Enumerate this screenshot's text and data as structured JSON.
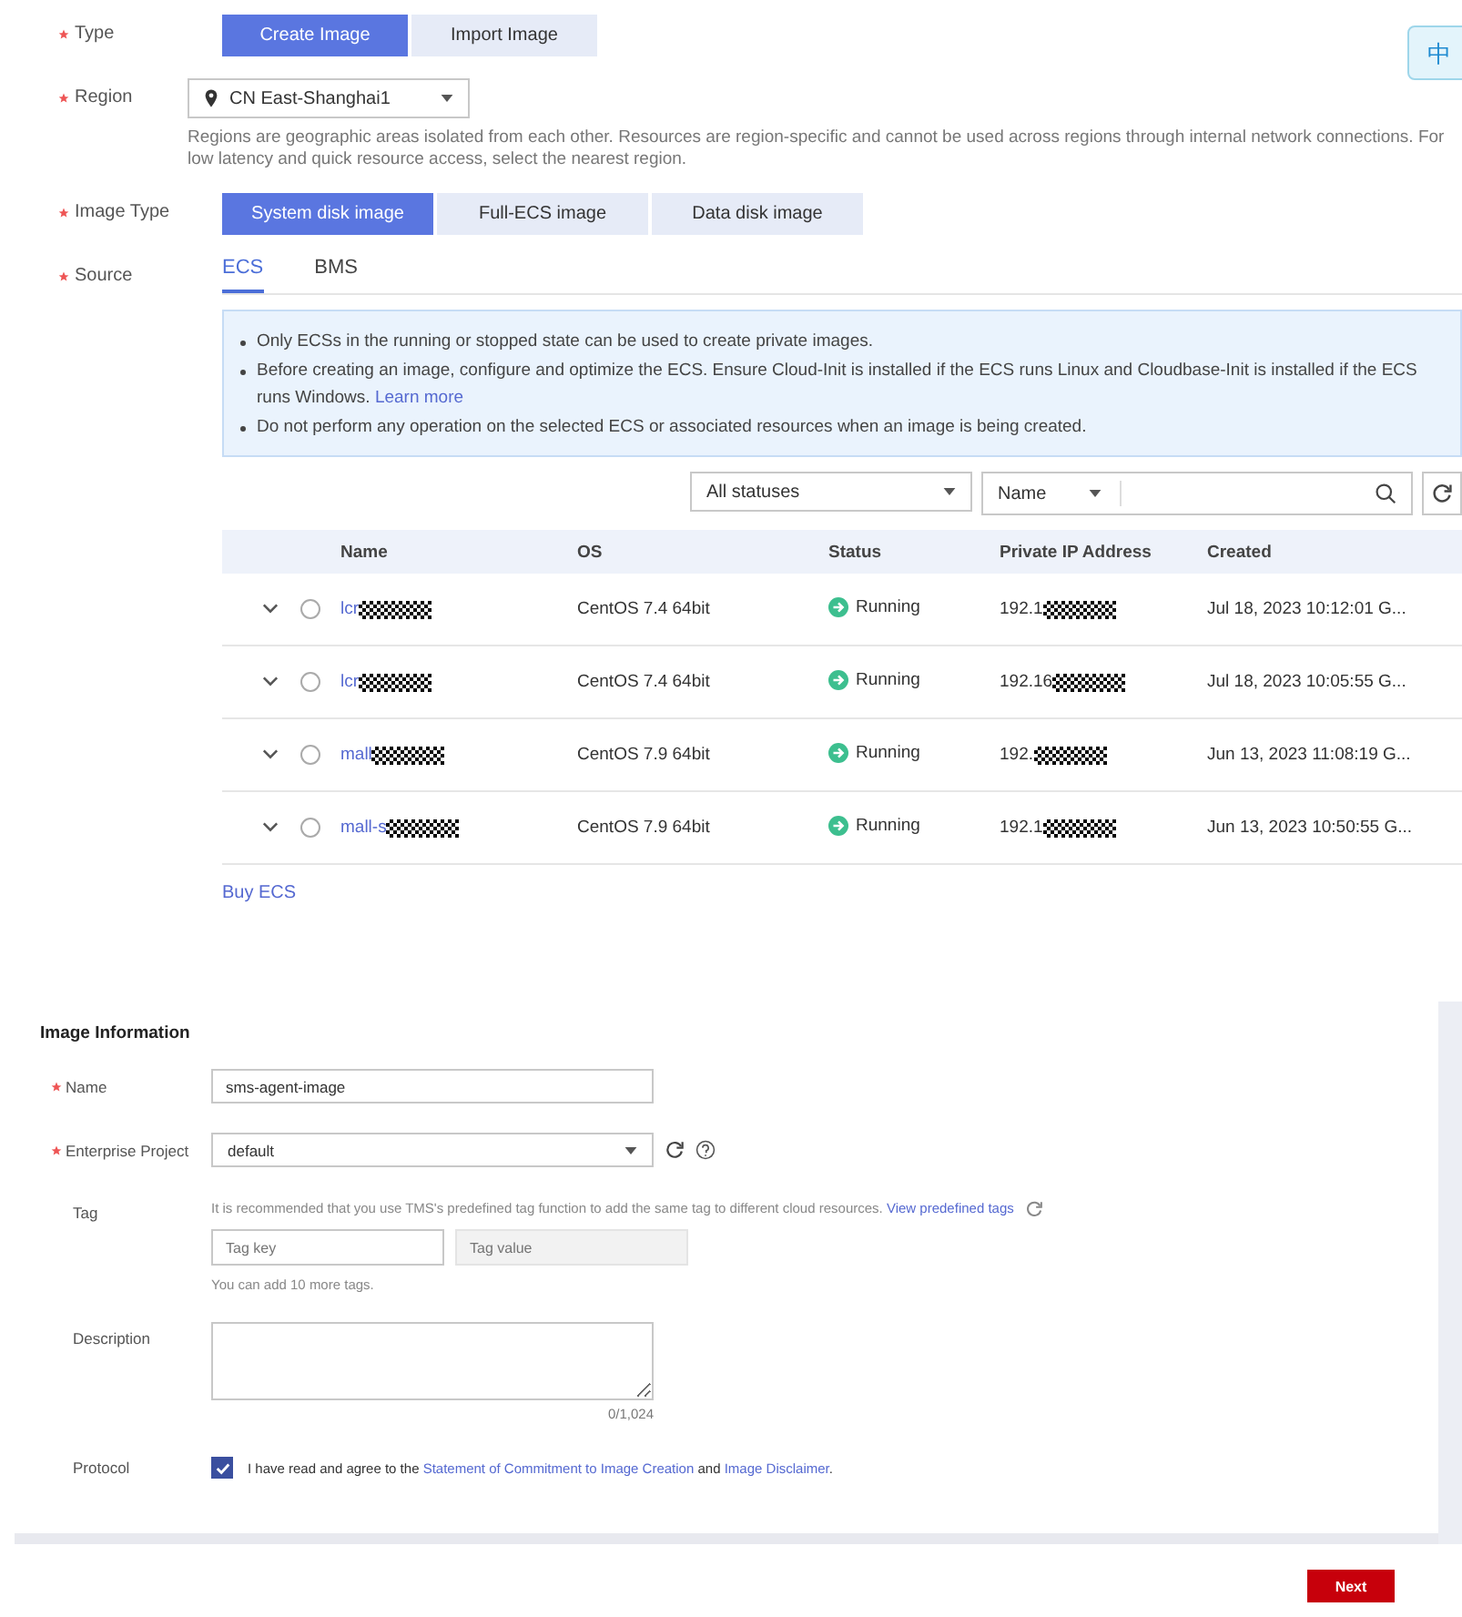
{
  "language_widget": {
    "label": "中"
  },
  "type": {
    "label": "Type",
    "required": true,
    "options": [
      {
        "label": "Create Image",
        "selected": true
      },
      {
        "label": "Import Image",
        "selected": false
      }
    ]
  },
  "region": {
    "label": "Region",
    "required": true,
    "value": "CN East-Shanghai1",
    "hint": "Regions are geographic areas isolated from each other. Resources are region-specific and cannot be used across regions through internal network connections. For low latency and quick resource access, select the nearest region."
  },
  "image_type": {
    "label": "Image Type",
    "required": true,
    "options": [
      {
        "label": "System disk image",
        "selected": true
      },
      {
        "label": "Full-ECS image",
        "selected": false
      },
      {
        "label": "Data disk image",
        "selected": false
      }
    ]
  },
  "source": {
    "label": "Source",
    "required": true,
    "tabs": [
      {
        "label": "ECS",
        "selected": true
      },
      {
        "label": "BMS",
        "selected": false
      }
    ]
  },
  "notice": {
    "items": [
      {
        "text": "Only ECSs in the running or stopped state can be used to create private images."
      },
      {
        "text": "Before creating an image, configure and optimize the ECS. Ensure Cloud-Init is installed if the ECS runs Linux and Cloudbase-Init is installed if the ECS runs Windows.",
        "link": "Learn more"
      },
      {
        "text": "Do not perform any operation on the selected ECS or associated resources when an image is being created."
      }
    ]
  },
  "filters": {
    "status": "All statuses",
    "search_by": "Name"
  },
  "table": {
    "columns": [
      "Name",
      "OS",
      "Status",
      "Private IP Address",
      "Created"
    ],
    "rows": [
      {
        "expanded": false,
        "selected": false,
        "name": "lcr",
        "os": "CentOS 7.4 64bit",
        "status": "Running",
        "ip": "192.1",
        "created": "Jul 18, 2023 10:12:01 G..."
      },
      {
        "expanded": false,
        "selected": false,
        "name": "lcr",
        "os": "CentOS 7.4 64bit",
        "status": "Running",
        "ip": "192.16",
        "created": "Jul 18, 2023 10:05:55 G..."
      },
      {
        "expanded": false,
        "selected": false,
        "name": "mall",
        "os": "CentOS 7.9 64bit",
        "status": "Running",
        "ip": "192.",
        "created": "Jun 13, 2023 11:08:19 G..."
      },
      {
        "expanded": false,
        "selected": false,
        "name": "mall-s",
        "os": "CentOS 7.9 64bit",
        "status": "Running",
        "ip": "192.1",
        "created": "Jun 13, 2023 10:50:55 G..."
      }
    ]
  },
  "buy_link": "Buy ECS",
  "image_information": {
    "title": "Image Information",
    "name": {
      "label": "Name",
      "required": true,
      "value": "sms-agent-image"
    },
    "enterprise_project": {
      "label": "Enterprise Project",
      "required": true,
      "value": "default"
    },
    "tag": {
      "label": "Tag",
      "required": false,
      "hint": "It is recommended that you use TMS's predefined tag function to add the same tag to different cloud resources.",
      "link": "View predefined tags",
      "key_placeholder": "Tag key",
      "value_placeholder": "Tag value",
      "note": "You can add 10 more tags."
    },
    "description": {
      "label": "Description",
      "required": false,
      "counter": "0/1,024"
    },
    "protocol": {
      "label": "Protocol",
      "required": false,
      "checked": true,
      "text_before": "I have read and agree to the",
      "link_1": "Statement of Commitment to Image Creation",
      "text_middle": "and",
      "link_2": "Image Disclaimer",
      "text_after": "."
    }
  },
  "next_button": "Next"
}
